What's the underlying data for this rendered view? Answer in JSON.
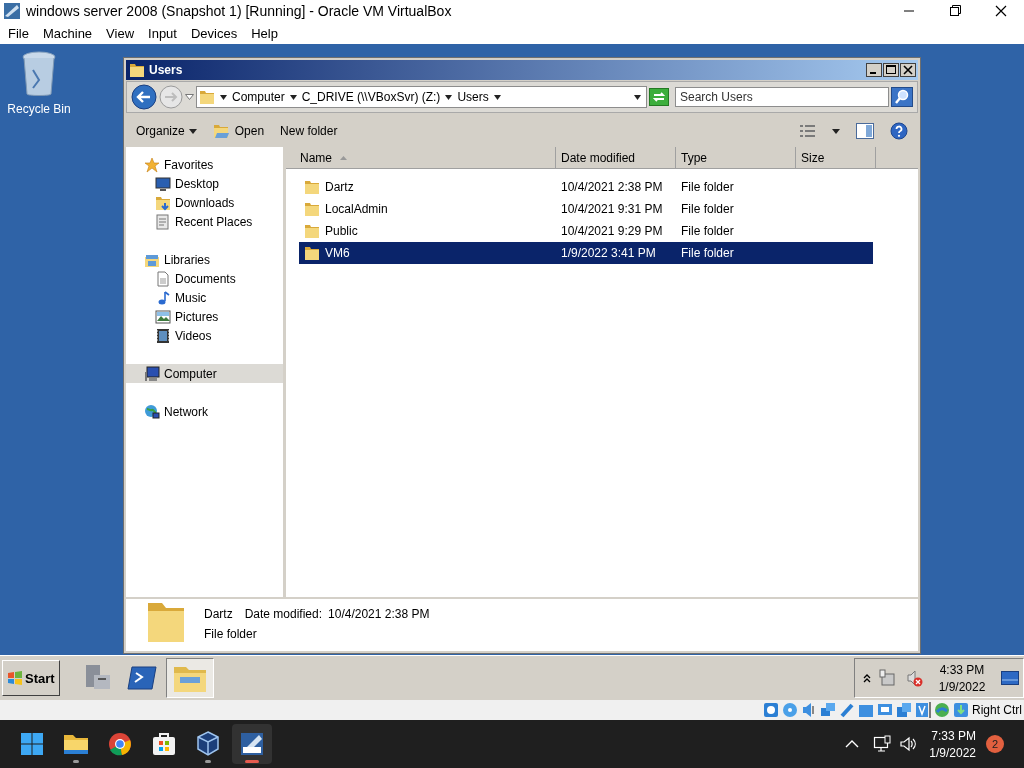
{
  "host_window": {
    "title": "windows server 2008 (Snapshot 1) [Running] - Oracle VM VirtualBox"
  },
  "menu": [
    "File",
    "Machine",
    "View",
    "Input",
    "Devices",
    "Help"
  ],
  "desktop_icons": [
    {
      "label": "Recycle Bin"
    }
  ],
  "explorer": {
    "title": "Users",
    "breadcrumb": [
      "Computer",
      "C_DRIVE (\\\\VBoxSvr) (Z:)",
      "Users"
    ],
    "search": {
      "placeholder": "Search Users"
    },
    "toolbar": [
      "Organize",
      "Open",
      "New folder"
    ],
    "nav": [
      {
        "label": "Favorites",
        "selected": false,
        "children": [
          {
            "label": "Desktop",
            "selected": false
          },
          {
            "label": "Downloads",
            "selected": false
          },
          {
            "label": "Recent Places",
            "selected": false
          }
        ]
      },
      {
        "label": "Libraries",
        "selected": false,
        "children": [
          {
            "label": "Documents",
            "selected": false
          },
          {
            "label": "Music",
            "selected": false
          },
          {
            "label": "Pictures",
            "selected": false
          },
          {
            "label": "Videos",
            "selected": false
          }
        ]
      },
      {
        "label": "Computer",
        "selected": true
      },
      {
        "label": "Network",
        "selected": false
      }
    ],
    "columns": [
      "Name",
      "Date modified",
      "Type",
      "Size"
    ],
    "rows": [
      {
        "name": "Dartz",
        "date": "10/4/2021 2:38 PM",
        "type": "File folder",
        "selected": false
      },
      {
        "name": "LocalAdmin",
        "date": "10/4/2021 9:31 PM",
        "type": "File folder",
        "selected": false
      },
      {
        "name": "Public",
        "date": "10/4/2021 9:29 PM",
        "type": "File folder",
        "selected": false
      },
      {
        "name": "VM6",
        "date": "1/9/2022 3:41 PM",
        "type": "File folder",
        "selected": true
      }
    ],
    "details": {
      "name": "Dartz",
      "date_label": "Date modified:",
      "date": "10/4/2021 2:38 PM",
      "type": "File folder"
    }
  },
  "guest_taskbar": {
    "start": "Start",
    "tasks": [
      {
        "kind": "server",
        "selected": false
      },
      {
        "kind": "shell",
        "selected": false
      },
      {
        "kind": "explorer",
        "selected": true
      }
    ],
    "time": "4:33 PM",
    "date": "1/9/2022"
  },
  "vbox_status": {
    "host_key": "Right Ctrl"
  },
  "host_taskbar": {
    "apps": [
      {
        "kind": "files",
        "running": true,
        "selected": false
      },
      {
        "kind": "browser",
        "running": false,
        "selected": false
      },
      {
        "kind": "store",
        "running": false,
        "selected": false
      },
      {
        "kind": "vbox",
        "running": true,
        "selected": false
      },
      {
        "kind": "vm",
        "running": true,
        "selected": true
      }
    ],
    "time": "7:33 PM",
    "date": "1/9/2022",
    "notifications": "2"
  }
}
